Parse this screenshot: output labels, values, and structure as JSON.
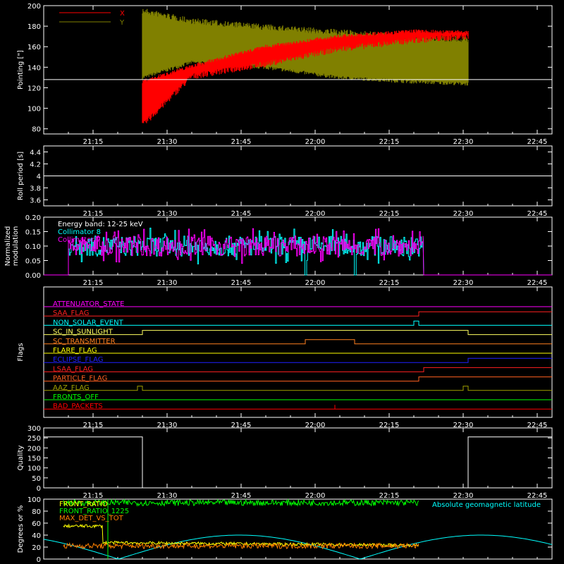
{
  "figure": {
    "background": "#000000",
    "foreground": "#ffffff"
  },
  "chart_data": [
    {
      "id": "pointing",
      "type": "line",
      "ylabel": "Pointing [\"]",
      "ylim": [
        75,
        200
      ],
      "yticks": [
        80,
        100,
        120,
        140,
        160,
        180,
        200
      ],
      "x_time_range": [
        "21:05",
        "22:48"
      ],
      "xticks": [
        "21:15",
        "21:30",
        "21:45",
        "22:00",
        "22:15",
        "22:30",
        "22:45"
      ],
      "legend": {
        "position": "top-left",
        "entries": [
          {
            "label": "X",
            "color": "#ff0000"
          },
          {
            "label": "Y",
            "color": "#808000"
          }
        ]
      },
      "reference_line": {
        "y": 128,
        "color": "#ffffff"
      },
      "series": [
        {
          "name": "X",
          "color": "#ff0000",
          "envelope": [
            {
              "t": "21:25",
              "low": 80,
              "high": 128
            },
            {
              "t": "21:35",
              "low": 128,
              "high": 143
            },
            {
              "t": "21:50",
              "low": 140,
              "high": 162
            },
            {
              "t": "22:05",
              "low": 155,
              "high": 172
            },
            {
              "t": "22:20",
              "low": 163,
              "high": 177
            },
            {
              "t": "22:31",
              "low": 167,
              "high": 176
            }
          ]
        },
        {
          "name": "Y",
          "color": "#808000",
          "envelope": [
            {
              "t": "21:25",
              "low": 128,
              "high": 198
            },
            {
              "t": "21:35",
              "low": 143,
              "high": 188
            },
            {
              "t": "21:50",
              "low": 138,
              "high": 182
            },
            {
              "t": "22:05",
              "low": 128,
              "high": 177
            },
            {
              "t": "22:20",
              "low": 124,
              "high": 172
            },
            {
              "t": "22:31",
              "low": 122,
              "high": 170
            }
          ]
        }
      ]
    },
    {
      "id": "roll_period",
      "type": "line",
      "ylabel": "Roll period [s]",
      "ylim": [
        3.5,
        4.5
      ],
      "yticks": [
        3.6,
        3.8,
        4.0,
        4.2,
        4.4
      ],
      "xticks": [
        "21:15",
        "21:30",
        "21:45",
        "22:00",
        "22:15",
        "22:30",
        "22:45"
      ],
      "series": [
        {
          "name": "",
          "color": "#ffffff",
          "constant": 4.0
        }
      ]
    },
    {
      "id": "modulation",
      "type": "line",
      "ylabel": "Normalized modulation",
      "ylabel_lines": [
        "Normalized",
        "modulation"
      ],
      "ylim": [
        0,
        0.2
      ],
      "yticks": [
        "0.00",
        "0.05",
        "0.10",
        "0.15",
        "0.20"
      ],
      "xticks": [
        "21:15",
        "21:30",
        "21:45",
        "22:00",
        "22:15",
        "22:30",
        "22:45"
      ],
      "legend": {
        "position": "top-left",
        "entries": [
          {
            "label": "Energy band: 12-25 keV",
            "color": "#ffffff"
          },
          {
            "label": "Collimator 8",
            "color": "#00ffff"
          },
          {
            "label": "Collimator 7",
            "color": "#ff00ff"
          }
        ]
      },
      "series": [
        {
          "name": "Collimator 8",
          "color": "#00ffff",
          "active": [
            "21:05",
            "22:22"
          ],
          "mean": 0.1,
          "spread": 0.035,
          "gaps": [
            "21:58",
            "22:08"
          ]
        },
        {
          "name": "Collimator 7",
          "color": "#ff00ff",
          "active": [
            "21:05",
            "22:22"
          ],
          "mean": 0.1,
          "spread": 0.035
        }
      ]
    },
    {
      "id": "flags",
      "type": "line",
      "ylabel": "Flags",
      "xticks": [
        "21:15",
        "21:30",
        "21:45",
        "22:00",
        "22:15",
        "22:30",
        "22:45"
      ],
      "flags": [
        {
          "label": "ATTENUATOR_STATE",
          "color": "#ff00ff",
          "steps": []
        },
        {
          "label": "SAA_FLAG",
          "color": "#ff2020",
          "steps": [
            [
              "22:21",
              1
            ]
          ]
        },
        {
          "label": "NON_SOLAR_EVENT",
          "color": "#00ffff",
          "steps": [
            [
              "22:20",
              1
            ],
            [
              "22:21",
              0
            ]
          ]
        },
        {
          "label": "SC_IN_SUNLIGHT",
          "color": "#ffff60",
          "steps": [
            [
              "21:25",
              1
            ],
            [
              "22:31",
              0
            ]
          ]
        },
        {
          "label": "SC_TRANSMITTER",
          "color": "#ff8020",
          "steps": [
            [
              "21:58",
              1
            ],
            [
              "22:08",
              0
            ]
          ]
        },
        {
          "label": "FLARE_FLAG",
          "color": "#ffff00",
          "steps": []
        },
        {
          "label": "ECLIPSE_FLAG",
          "color": "#2020ff",
          "steps": [
            [
              "21:25",
              0
            ],
            [
              "22:31",
              1
            ]
          ]
        },
        {
          "label": "LSAA_FLAG",
          "color": "#ff2020",
          "steps": [
            [
              "22:22",
              1
            ]
          ]
        },
        {
          "label": "PARTICLE_FLAG",
          "color": "#ff6020",
          "steps": [
            [
              "22:21",
              1
            ]
          ]
        },
        {
          "label": "AAZ_FLAG",
          "color": "#a0a000",
          "steps": [
            [
              "21:24",
              1
            ],
            [
              "21:25",
              0
            ],
            [
              "22:30",
              1
            ],
            [
              "22:31",
              0
            ]
          ]
        },
        {
          "label": "FRONTS_OFF",
          "color": "#00ff00",
          "steps": []
        },
        {
          "label": "BAD_PACKETS",
          "color": "#ff0000",
          "steps": [
            [
              "22:04",
              1
            ],
            [
              "22:04",
              0
            ]
          ]
        }
      ]
    },
    {
      "id": "quality",
      "type": "line",
      "ylabel": "Quality",
      "ylim": [
        0,
        300
      ],
      "yticks": [
        0,
        50,
        100,
        150,
        200,
        250,
        300
      ],
      "xticks": [
        "21:15",
        "21:30",
        "21:45",
        "22:00",
        "22:15",
        "22:30",
        "22:45"
      ],
      "series": [
        {
          "name": "",
          "color": "#ffffff",
          "steps": [
            [
              "21:05",
              255
            ],
            [
              "21:25",
              0
            ],
            [
              "22:31",
              255
            ],
            [
              "22:48",
              255
            ]
          ]
        }
      ]
    },
    {
      "id": "ratios",
      "type": "line",
      "ylabel": "Degrees or %",
      "ylim": [
        0,
        100
      ],
      "yticks": [
        0,
        20,
        40,
        60,
        80,
        100
      ],
      "legend": {
        "position": "top-left",
        "entries": [
          {
            "label": "FRONT_RATIO",
            "color": "#ffff00"
          },
          {
            "label": "FRONT_RATIO_1225",
            "color": "#00ff00"
          },
          {
            "label": "MAX_DET_VS_TOT",
            "color": "#ff8000"
          }
        ]
      },
      "annotation": {
        "text": "Absolute geomagnetic latitude",
        "color": "#00ffff"
      },
      "series": [
        {
          "name": "FRONT_RATIO",
          "color": "#ffff00"
        },
        {
          "name": "FRONT_RATIO_1225",
          "color": "#00ff00"
        },
        {
          "name": "MAX_DET_VS_TOT",
          "color": "#ff8000"
        },
        {
          "name": "Absolute geomagnetic latitude",
          "color": "#00ffff"
        }
      ]
    }
  ]
}
